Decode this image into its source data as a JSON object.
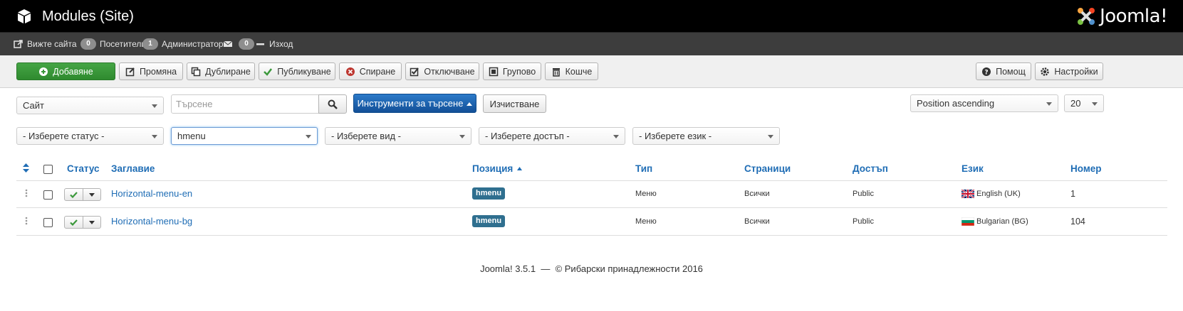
{
  "header": {
    "title": "Modules (Site)",
    "logo_text": "Joomla!"
  },
  "statusbar": {
    "view_site": "Вижте сайта",
    "visitors_count": "0",
    "visitors_label": "Посетители",
    "admins_count": "1",
    "admins_label": "Администратор",
    "messages_count": "0",
    "logout_label": "Изход"
  },
  "toolbar": {
    "add": "Добавяне",
    "edit": "Промяна",
    "duplicate": "Дублиране",
    "publish": "Публикуване",
    "unpublish": "Спиране",
    "checkin": "Отключване",
    "batch": "Групово",
    "trash": "Кошче",
    "help": "Помощ",
    "options": "Настройки"
  },
  "filters": {
    "client": "Сайт",
    "search_placeholder": "Търсене",
    "search_tools": "Инструменти за търсене",
    "clear": "Изчистване",
    "ordering": "Position ascending",
    "limit": "20",
    "status": "- Изберете статус -",
    "position": "hmenu",
    "type": "- Изберете вид -",
    "access": "- Изберете достъп -",
    "language": "- Изберете език -"
  },
  "table": {
    "headers": {
      "status": "Статус",
      "title": "Заглавие",
      "position": "Позиция",
      "type": "Тип",
      "pages": "Страници",
      "access": "Достъп",
      "language": "Език",
      "id": "Номер"
    },
    "rows": [
      {
        "title": "Horizontal-menu-en",
        "position": "hmenu",
        "type": "Меню",
        "pages": "Всички",
        "access": "Public",
        "language": "English (UK)",
        "id": "1"
      },
      {
        "title": "Horizontal-menu-bg",
        "position": "hmenu",
        "type": "Меню",
        "pages": "Всички",
        "access": "Public",
        "language": "Bulgarian (BG)",
        "id": "104"
      }
    ]
  },
  "footer": {
    "text": "Joomla! 3.5.1  —  © Рибарски принадлежности 2016"
  },
  "colors": {
    "header_bg": "#000000",
    "statusbar_bg": "#3d3d3d",
    "success": "#3b983b",
    "primary": "#1d62ad",
    "link": "#1f6db5",
    "position_badge": "#2f6f8f"
  }
}
